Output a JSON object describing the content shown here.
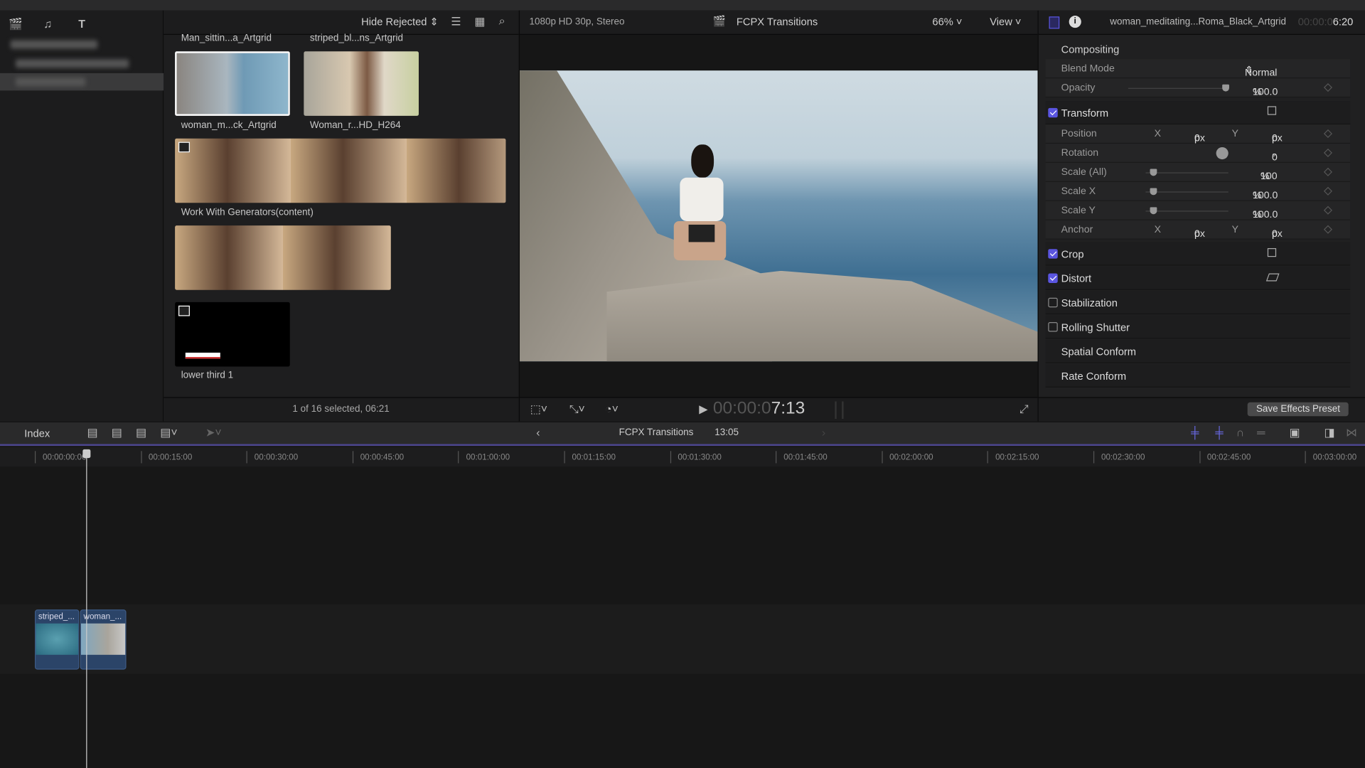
{
  "browser": {
    "filter": "Hide Rejected",
    "clips": [
      {
        "name": "Man_sittin...a_Artgrid"
      },
      {
        "name": "striped_bl...ns_Artgrid"
      },
      {
        "name": "woman_m...ck_Artgrid"
      },
      {
        "name": "Woman_r...HD_H264"
      },
      {
        "name": "Work With Generators(content)"
      },
      {
        "name": "lower third 1"
      }
    ],
    "status": "1 of 16 selected, 06:21"
  },
  "viewer": {
    "format": "1080p HD 30p, Stereo",
    "project": "FCPX Transitions",
    "zoom": "66%",
    "view_label": "View",
    "timecode_dim": "00:00:0",
    "timecode": "7:13"
  },
  "inspector": {
    "clip_name": "woman_meditating...Roma_Black_Artgrid",
    "duration_dim": "00:00:0",
    "duration": "6:20",
    "compositing": "Compositing",
    "blend_mode_label": "Blend Mode",
    "blend_mode": "Normal",
    "opacity_label": "Opacity",
    "opacity": "100.0",
    "opacity_unit": "%",
    "opacity_level": 1.0,
    "transform": {
      "label": "Transform",
      "enabled": true,
      "position_label": "Position",
      "position_x": "0",
      "position_y": "0",
      "rotation_label": "Rotation",
      "rotation": "0",
      "rotation_unit": "°",
      "scale_all_label": "Scale (All)",
      "scale_all": "100",
      "scale_x_label": "Scale X",
      "scale_x": "100.0",
      "scale_y_label": "Scale Y",
      "scale_y": "100.0",
      "anchor_label": "Anchor",
      "anchor_x": "0",
      "anchor_y": "0",
      "x": "X",
      "y": "Y",
      "px": "px",
      "pct": "%"
    },
    "crop": {
      "label": "Crop",
      "enabled": true
    },
    "distort": {
      "label": "Distort",
      "enabled": true
    },
    "stabilization": {
      "label": "Stabilization",
      "enabled": false
    },
    "rolling_shutter": {
      "label": "Rolling Shutter",
      "enabled": false
    },
    "spatial_conform": "Spatial Conform",
    "rate_conform": "Rate Conform",
    "save_preset": "Save Effects Preset"
  },
  "timeline": {
    "index": "Index",
    "project": "FCPX Transitions",
    "duration": "13:05",
    "ticks": [
      "00:00:00:00",
      "00:00:15:00",
      "00:00:30:00",
      "00:00:45:00",
      "00:01:00:00",
      "00:01:15:00",
      "00:01:30:00",
      "00:01:45:00",
      "00:02:00:00",
      "00:02:15:00",
      "00:02:30:00",
      "00:02:45:00",
      "00:03:00:00"
    ],
    "clips": [
      {
        "name": "striped_..."
      },
      {
        "name": "woman_..."
      }
    ]
  },
  "colors": {
    "accent": "#5a55e0",
    "clip": "#2b4468"
  }
}
